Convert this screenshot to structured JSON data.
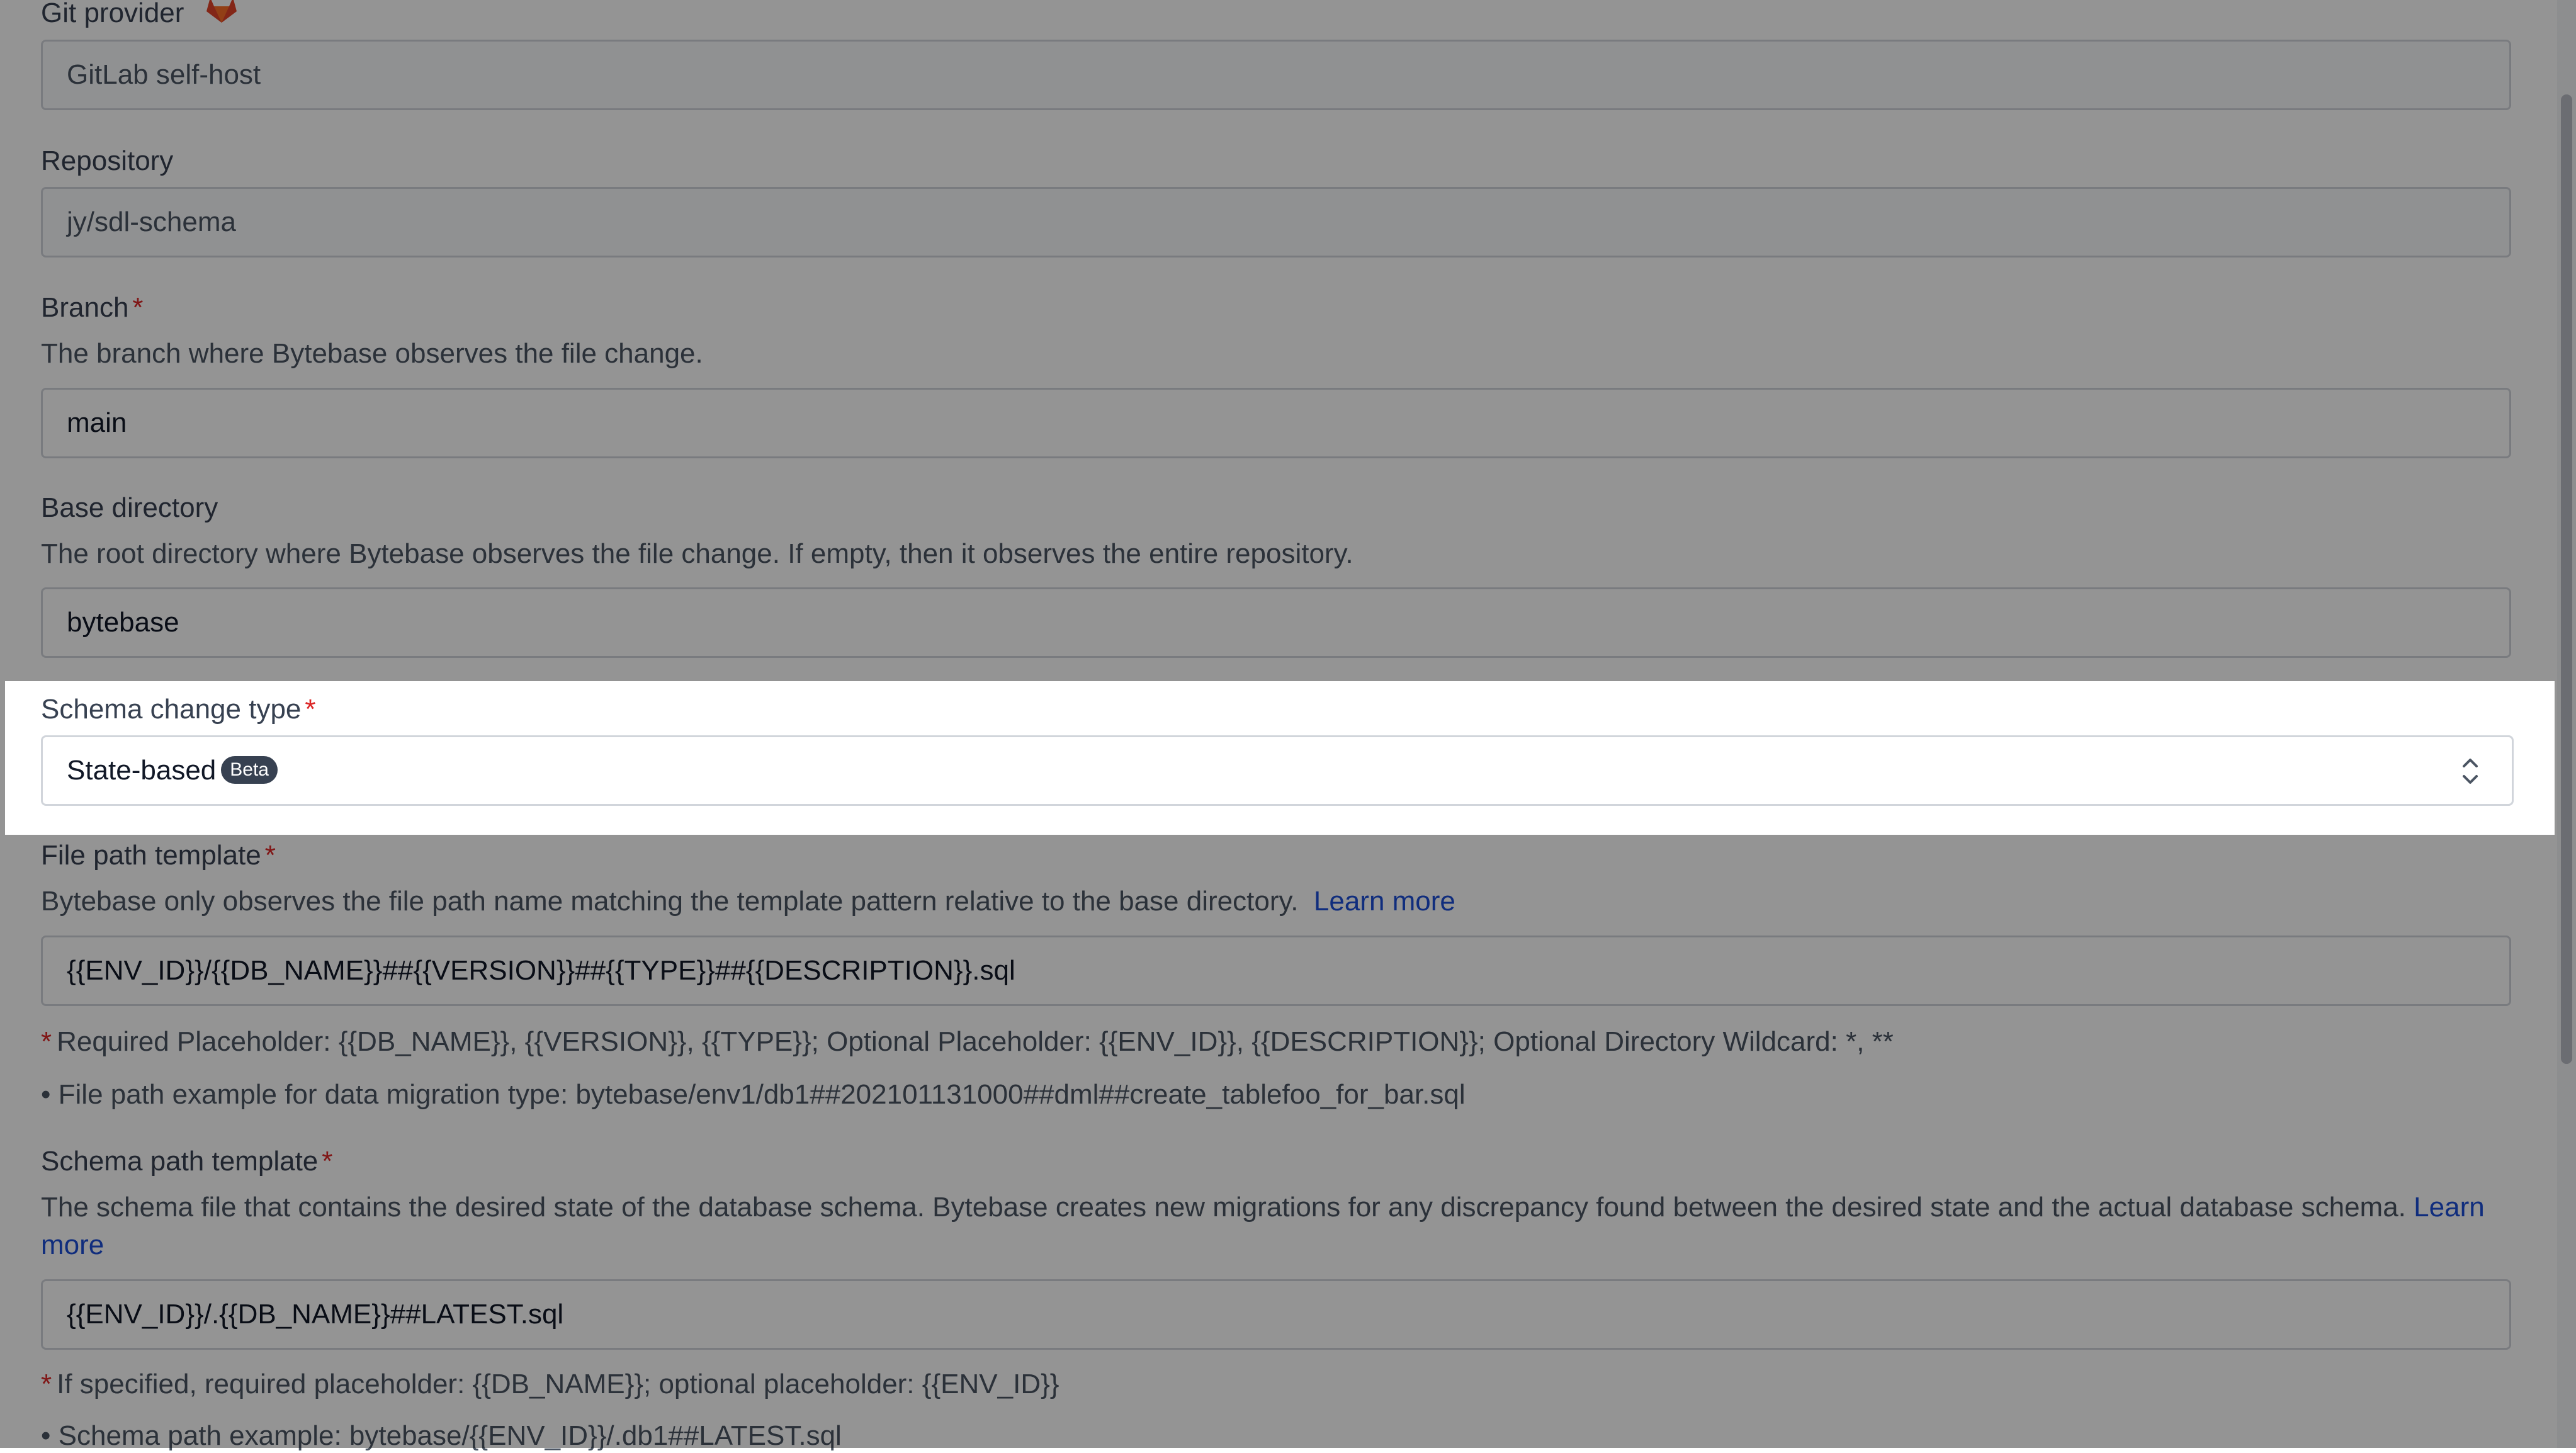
{
  "git_provider": {
    "label": "Git provider",
    "icon": "gitlab-icon",
    "value": "GitLab self-host"
  },
  "repository": {
    "label": "Repository",
    "value": "jy/sdl-schema"
  },
  "branch": {
    "label": "Branch",
    "required_mark": "*",
    "description": "The branch where Bytebase observes the file change.",
    "value": "main"
  },
  "base_directory": {
    "label": "Base directory",
    "description": "The root directory where Bytebase observes the file change. If empty, then it observes the entire repository.",
    "value": "bytebase"
  },
  "schema_change_type": {
    "label": "Schema change type",
    "required_mark": "*",
    "value": "State-based",
    "badge": "Beta",
    "icon": "chevron-up-down-icon"
  },
  "file_path_template": {
    "label": "File path template",
    "required_mark": "*",
    "description": "Bytebase only observes the file path name matching the template pattern relative to the base directory.",
    "learn_more": "Learn more",
    "value": "{{ENV_ID}}/{{DB_NAME}}##{{VERSION}}##{{TYPE}}##{{DESCRIPTION}}.sql",
    "note_required": "Required Placeholder: {{DB_NAME}}, {{VERSION}}, {{TYPE}}; Optional Placeholder: {{ENV_ID}}, {{DESCRIPTION}}; Optional Directory Wildcard: *, **",
    "note_example": "File path example for data migration type: bytebase/env1/db1##202101131000##dml##create_tablefoo_for_bar.sql"
  },
  "schema_path_template": {
    "label": "Schema path template",
    "required_mark": "*",
    "description": "The schema file that contains the desired state of the database schema. Bytebase creates new migrations for any discrepancy found between the desired state and the actual database schema.",
    "learn_more": "Learn more",
    "value": "{{ENV_ID}}/.{{DB_NAME}}##LATEST.sql",
    "note_required": "If specified, required placeholder: {{DB_NAME}}; optional placeholder: {{ENV_ID}}",
    "note_example": "Schema path example: bytebase/{{ENV_ID}}/.db1##LATEST.sql"
  },
  "colors": {
    "overlay": "#00000069",
    "required": "#dc2626",
    "link": "#1d4ed8",
    "badge": "#374151"
  }
}
